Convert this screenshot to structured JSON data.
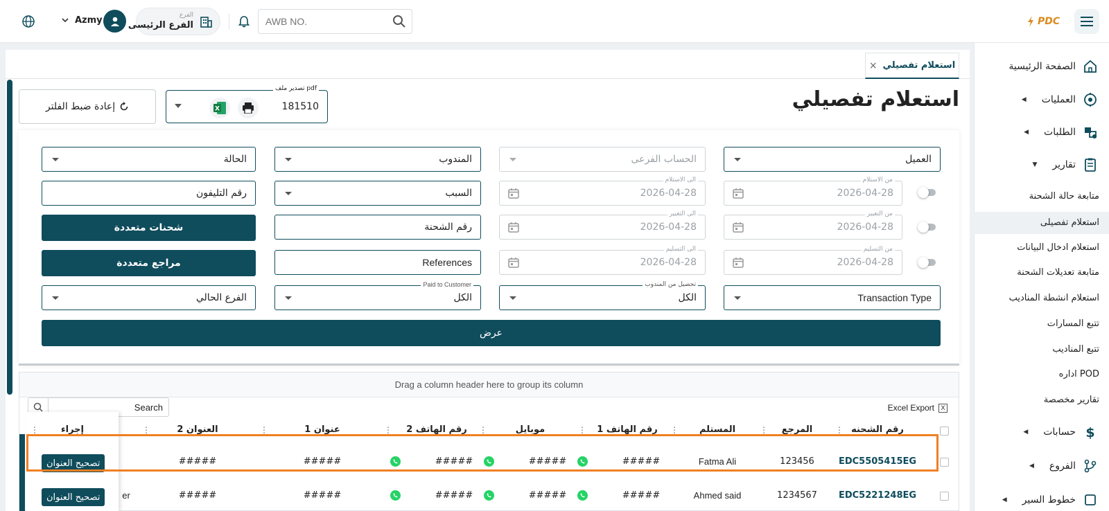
{
  "topbar": {
    "search_placeholder": "AWB NO.",
    "branch_label": "الفرع",
    "branch_name": "الفرع الرئيسى",
    "username": "Azmy",
    "logo_text": "PDC"
  },
  "sidebar": {
    "home": "الصفحة الرئيسية",
    "operations": "العمليات",
    "orders": "الطلبات",
    "reports": "تقارير",
    "report_items": [
      "متابعة حالة الشحنة",
      "استعلام تفصيلى",
      "استعلام ادخال البيانات",
      "متابعة تعديلات الشحنة",
      "استعلام انشطة المناديب",
      "تتبع المسارات",
      "تتبع المناديب",
      "اداره POD",
      "تقارير مخصصة"
    ],
    "accounts": "حسابات",
    "branches": "الفروع",
    "routes": "خطوط السير"
  },
  "tab": {
    "label": "استعلام تفصيلي",
    "close": "×"
  },
  "page": {
    "title": "استعلام تفصيلي",
    "export_legend": "تصدير ملف pdf",
    "export_count": "181510",
    "reset_label": "إعادة ضبط الفلتر"
  },
  "filters": {
    "customer": "العميل",
    "sub_account": "الحساب الفرعى",
    "courier": "المندوب",
    "status": "الحالة",
    "from_receive_legend": "من الاستلام",
    "to_receive_legend": "الى الاستلام",
    "from_change_legend": "من التغيير",
    "to_change_legend": "الى التغيير",
    "from_delivery_legend": "من التسليم",
    "to_delivery_legend": "الى التسليم",
    "date_value": "2026-04-28",
    "reason": "السبب",
    "phone": "رقم التليفون",
    "awb": "رقم الشحنة",
    "references": "References",
    "multi_shipments": "شحنات متعددة",
    "multi_refs": "مراجع متعددة",
    "transaction_type": "Transaction Type",
    "collect_legend": "تحصيل من المندوب",
    "collect_value": "الكل",
    "paid_legend": "Paid to Customer",
    "paid_value": "الكل",
    "current_branch": "الفرع الحالي",
    "show": "عرض"
  },
  "grid": {
    "group_hint": "Drag a column header here to group its column",
    "search_label": "Search",
    "excel_export": "Excel Export",
    "columns": [
      "رقم الشحنه",
      "المرجع",
      "المستلم",
      "رقم الهاتف 1",
      "موبايل",
      "رقم الهاتف 2",
      "1 عنوان",
      "العنوان 2",
      "إجراء"
    ],
    "rows": [
      {
        "awb": "EDC5505415EG",
        "ref": "123456",
        "recipient": "Fatma Ali",
        "phone1": "#####",
        "mobile": "#####",
        "phone2": "#####",
        "addr1": "#####",
        "addr2": "#####",
        "action": "تصحيح العنوان",
        "overflow": ""
      },
      {
        "awb": "EDC5221248EG",
        "ref": "1234567",
        "recipient": "Ahmed said",
        "phone1": "#####",
        "mobile": "#####",
        "phone2": "#####",
        "addr1": "#####",
        "addr2": "#####",
        "action": "تصحيح العنوان",
        "overflow": "er"
      }
    ]
  },
  "colors": {
    "primary": "#0f4c5c",
    "highlight": "#f07f22",
    "logo": "#d98b1e",
    "whatsapp": "#25d366"
  }
}
